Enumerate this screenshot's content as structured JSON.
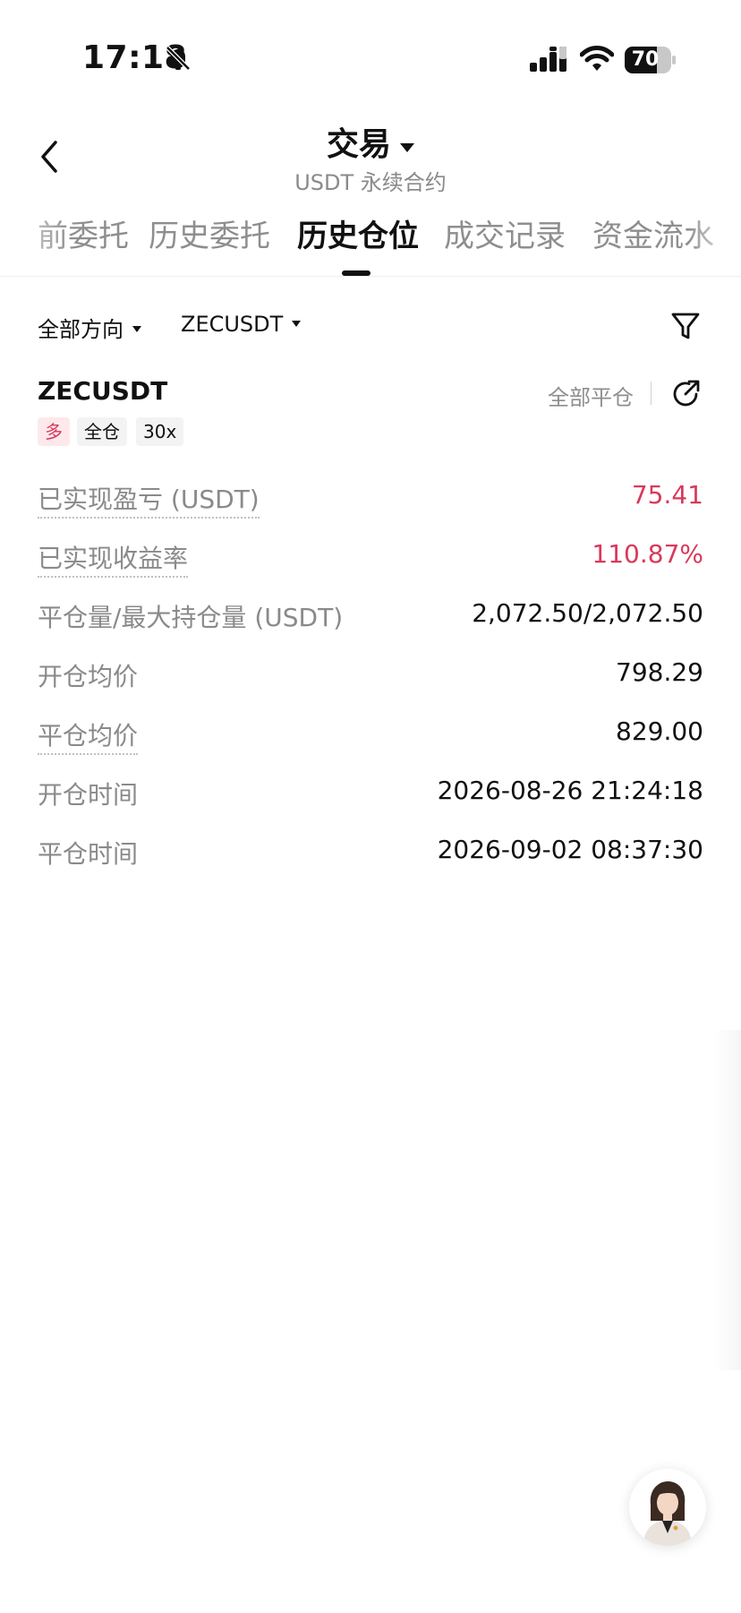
{
  "status_bar": {
    "time": "17:18",
    "battery": 70,
    "battery_label": "70"
  },
  "header": {
    "title": "交易",
    "subtitle": "USDT 永续合约"
  },
  "tabs": [
    {
      "label": "当前委托",
      "visible_label": "前委托",
      "active": false
    },
    {
      "label": "历史委托",
      "active": false
    },
    {
      "label": "历史仓位",
      "active": true
    },
    {
      "label": "成交记录",
      "active": false
    },
    {
      "label": "资金流水",
      "visible_label": "资金流水",
      "active": false
    }
  ],
  "filters": {
    "direction": "全部方向",
    "symbol": "ZECUSDT"
  },
  "position": {
    "symbol": "ZECUSDT",
    "close_type": "全部平仓",
    "tags": {
      "side": "多",
      "margin_mode": "全仓",
      "leverage": "30x"
    },
    "rows": [
      {
        "label": "已实现盈亏 (USDT)",
        "value": "75.41"
      },
      {
        "label": "已实现收益率",
        "value": "110.87%"
      },
      {
        "label": "平仓量/最大持仓量 (USDT)",
        "value": "2,072.50/2,072.50"
      },
      {
        "label": "开仓均价",
        "value": "798.29"
      },
      {
        "label": "平仓均价",
        "value": "829.00"
      },
      {
        "label": "开仓时间",
        "value": "2026-08-26 21:24:18"
      },
      {
        "label": "平仓时间",
        "value": "2026-09-02 08:37:30"
      }
    ]
  },
  "colors": {
    "positive": "#d8395b",
    "text_primary": "#111111",
    "text_secondary": "#8a8a8a"
  },
  "icons": {
    "back": "chevron-left-icon",
    "title_dropdown": "caret-down-icon",
    "filter": "funnel-icon",
    "share": "share-arrow-icon",
    "bell": "bell-slash-icon",
    "support": "support-avatar-icon"
  }
}
